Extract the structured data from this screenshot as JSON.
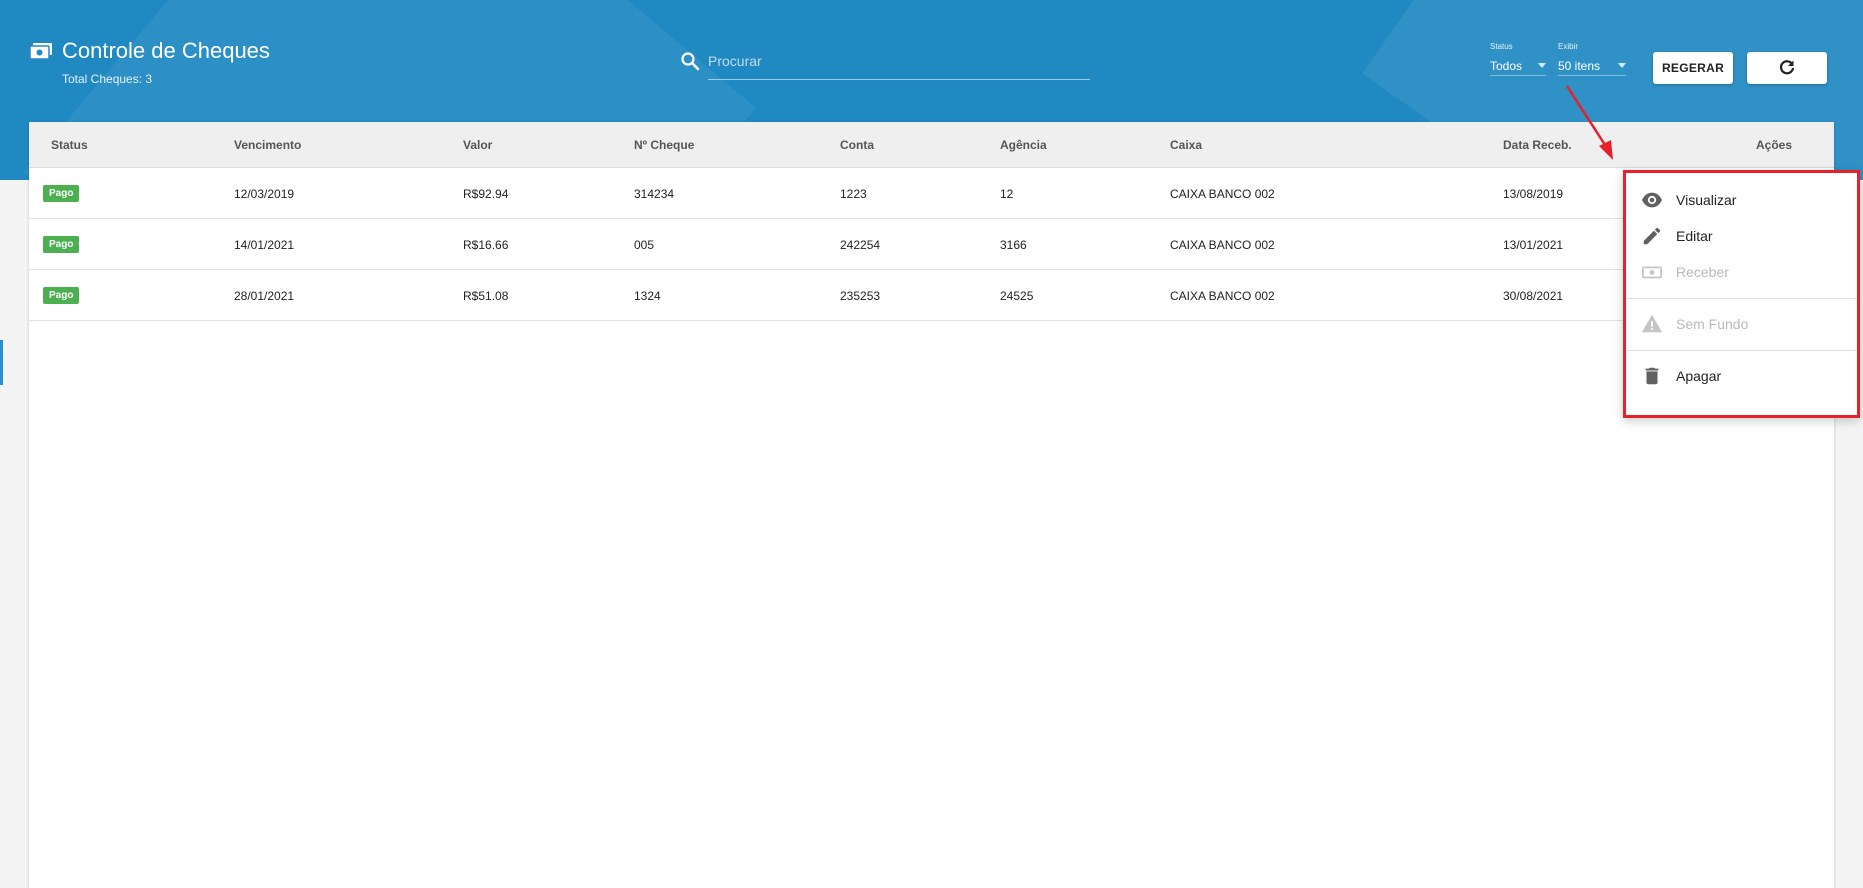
{
  "header": {
    "title": "Controle de Cheques",
    "subtitle": "Total Cheques: 3",
    "search_placeholder": "Procurar",
    "status_label": "Status",
    "status_value": "Todos",
    "exibir_label": "Exibir",
    "exibir_value": "50 itens",
    "regerar_label": "REGERAR",
    "title_icon": "money-icon",
    "search_icon": "search-icon",
    "refresh_icon": "refresh-icon"
  },
  "table": {
    "columns": [
      "Status",
      "Vencimento",
      "Valor",
      "Nº Cheque",
      "Conta",
      "Agência",
      "Caixa",
      "Data Receb.",
      "Ações"
    ],
    "rows": [
      {
        "status": "Pago",
        "vencimento": "12/03/2019",
        "valor": "R$92.94",
        "cheque": "314234",
        "conta": "1223",
        "agencia": "12",
        "caixa": "CAIXA BANCO 002",
        "data_receb": "13/08/2019"
      },
      {
        "status": "Pago",
        "vencimento": "14/01/2021",
        "valor": "R$16.66",
        "cheque": "005",
        "conta": "242254",
        "agencia": "3166",
        "caixa": "CAIXA BANCO 002",
        "data_receb": "13/01/2021"
      },
      {
        "status": "Pago",
        "vencimento": "28/01/2021",
        "valor": "R$51.08",
        "cheque": "1324",
        "conta": "235253",
        "agencia": "24525",
        "caixa": "CAIXA BANCO 002",
        "data_receb": "30/08/2021"
      }
    ]
  },
  "menu": {
    "items": [
      {
        "label": "Visualizar",
        "icon": "eye-icon",
        "enabled": true
      },
      {
        "label": "Editar",
        "icon": "pencil-icon",
        "enabled": true
      },
      {
        "label": "Receber",
        "icon": "money-icon",
        "enabled": false
      },
      {
        "label": "Sem Fundo",
        "icon": "warning-icon",
        "enabled": false
      },
      {
        "label": "Apagar",
        "icon": "trash-icon",
        "enabled": true
      }
    ]
  },
  "colors": {
    "header_bg": "#2189c2",
    "badge_paid": "#4caf50",
    "highlight": "#e8202a"
  }
}
